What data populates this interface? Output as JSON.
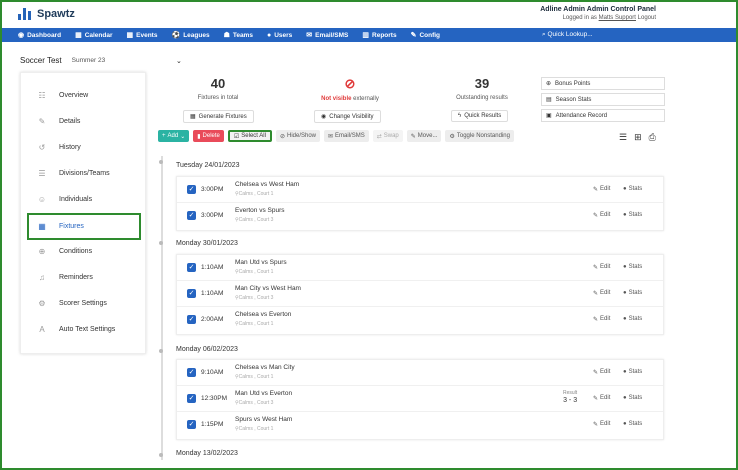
{
  "app": {
    "name": "Spawtz"
  },
  "admin": {
    "title": "Adline Admin Admin Control Panel",
    "logged_prefix": "Logged in as",
    "user": "Matts Support",
    "logout": "Logout"
  },
  "nav": {
    "items": [
      {
        "label": "Dashboard",
        "icon": "dashboard-icon"
      },
      {
        "label": "Calendar",
        "icon": "calendar-icon"
      },
      {
        "label": "Events",
        "icon": "events-icon"
      },
      {
        "label": "Leagues",
        "icon": "leagues-icon"
      },
      {
        "label": "Teams",
        "icon": "teams-icon"
      },
      {
        "label": "Users",
        "icon": "users-icon"
      },
      {
        "label": "Email/SMS",
        "icon": "email-icon"
      },
      {
        "label": "Reports",
        "icon": "reports-icon"
      },
      {
        "label": "Config",
        "icon": "wrench-icon"
      }
    ],
    "quick": "Quick Lookup..."
  },
  "context": {
    "league": "Soccer Test",
    "season": "Summer 23",
    "caret": "⌄"
  },
  "sidebar": {
    "items": [
      {
        "label": "Overview",
        "icon": "overview-icon"
      },
      {
        "label": "Details",
        "icon": "pencil-icon"
      },
      {
        "label": "History",
        "icon": "history-icon"
      },
      {
        "label": "Divisions/Teams",
        "icon": "list-icon"
      },
      {
        "label": "Individuals",
        "icon": "people-icon"
      },
      {
        "label": "Fixtures",
        "icon": "calendar-icon"
      },
      {
        "label": "Conditions",
        "icon": "globe-icon"
      },
      {
        "label": "Reminders",
        "icon": "bell-icon"
      },
      {
        "label": "Scorer Settings",
        "icon": "gears-icon"
      },
      {
        "label": "Auto Text Settings",
        "icon": "text-icon"
      }
    ],
    "active": "Fixtures"
  },
  "stats": {
    "fixtures_total": "40",
    "fixtures_label": "Fixtures in total",
    "generate": "Generate Fixtures",
    "not_visible_bold": "Not visible",
    "not_visible_rest": "externally",
    "change_visibility": "Change Visibility",
    "outstanding": "39",
    "outstanding_label": "Outstanding results",
    "quick_results": "Quick Results"
  },
  "right_boxes": [
    "Bonus Points",
    "Season Stats",
    "Attendance Record"
  ],
  "toolbar": {
    "add": "Add",
    "delete": "Delete",
    "select_all": "Select All",
    "hide_show": "Hide/Show",
    "email": "Email/SMS",
    "swap": "Swap",
    "move": "Move...",
    "toggle": "Toggle Nonstanding"
  },
  "labels": {
    "edit": "Edit",
    "stats": "Stats",
    "result": "Result"
  },
  "groups": [
    {
      "date": "Tuesday 24/01/2023",
      "rows": [
        {
          "time": "3:00PM",
          "match": "Chelsea vs West Ham",
          "venue": "Calms , Court 1",
          "score": ""
        },
        {
          "time": "3:00PM",
          "match": "Everton vs Spurs",
          "venue": "Calms , Court 3",
          "score": ""
        }
      ]
    },
    {
      "date": "Monday 30/01/2023",
      "rows": [
        {
          "time": "1:10AM",
          "match": "Man Utd vs Spurs",
          "venue": "Calms , Court 1",
          "score": ""
        },
        {
          "time": "1:10AM",
          "match": "Man City vs West Ham",
          "venue": "Calms , Court 3",
          "score": ""
        },
        {
          "time": "2:00AM",
          "match": "Chelsea vs Everton",
          "venue": "Calms , Court 1",
          "score": ""
        }
      ]
    },
    {
      "date": "Monday 06/02/2023",
      "rows": [
        {
          "time": "9:10AM",
          "match": "Chelsea vs Man City",
          "venue": "Calms , Court 1",
          "score": ""
        },
        {
          "time": "12:30PM",
          "match": "Man Utd vs Everton",
          "venue": "Calms , Court 3",
          "score": "3 - 3"
        },
        {
          "time": "1:15PM",
          "match": "Spurs vs West Ham",
          "venue": "Calms , Court 1",
          "score": ""
        }
      ]
    },
    {
      "date": "Monday 13/02/2023",
      "rows": []
    }
  ]
}
